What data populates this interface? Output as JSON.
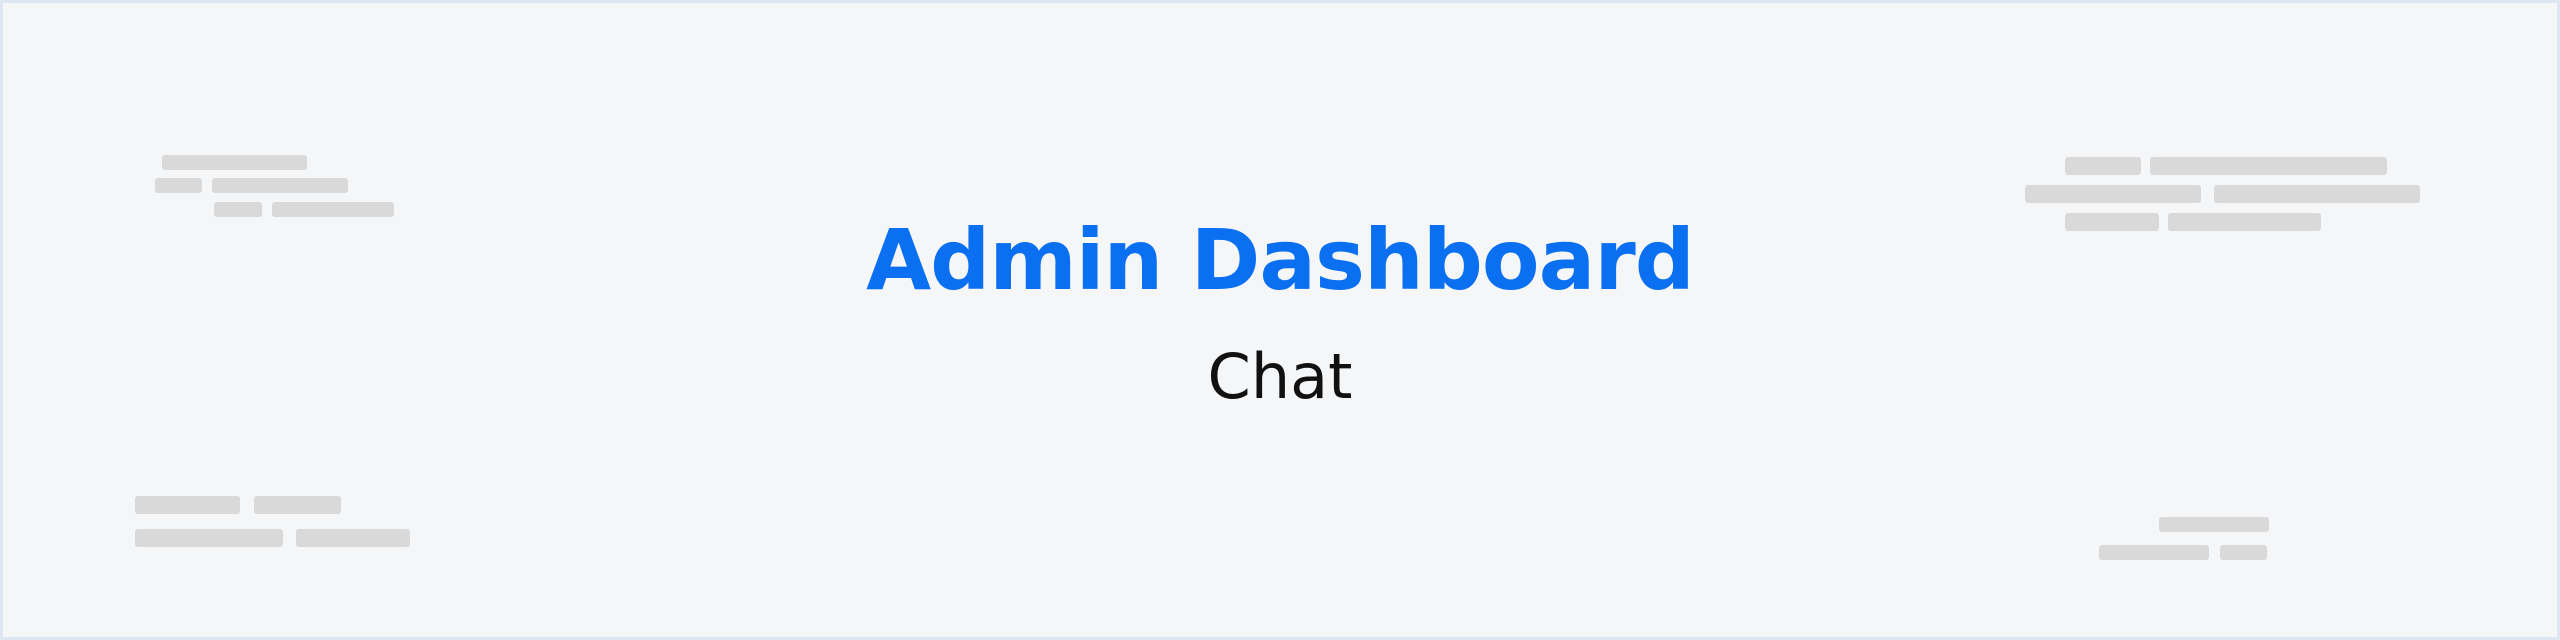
{
  "header": {
    "title": "Admin Dashboard",
    "subtitle": "Chat"
  },
  "colors": {
    "title": "#0a6ff0",
    "subtitle": "#111111",
    "background": "#f5f6f8",
    "placeholder": "#d9d9d9",
    "border": "#dfe6f3"
  }
}
